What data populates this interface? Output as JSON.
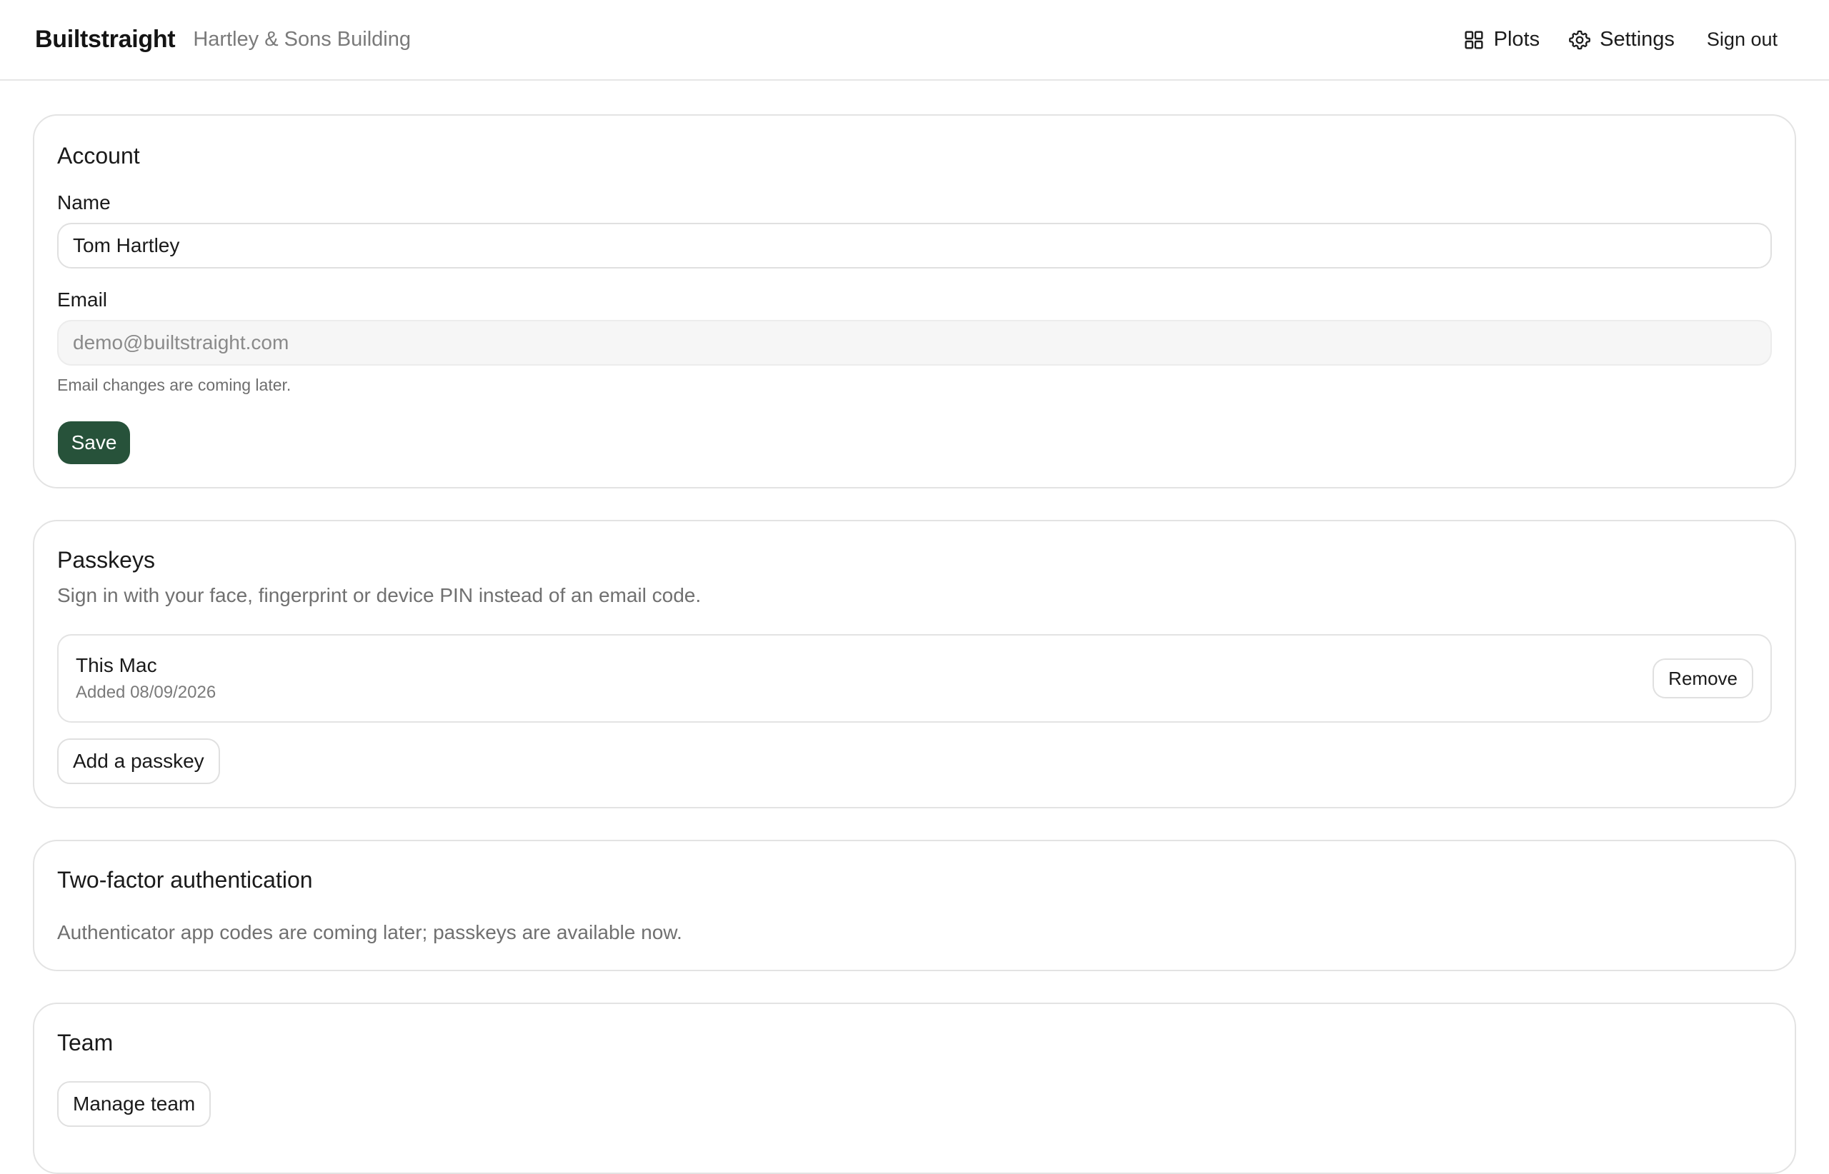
{
  "header": {
    "brand": "Builtstraight",
    "organization": "Hartley & Sons Building",
    "nav": {
      "plots_label": "Plots",
      "plots_icon": "grid-icon",
      "settings_label": "Settings",
      "settings_icon": "gear-icon",
      "signout_label": "Sign out"
    }
  },
  "account": {
    "title": "Account",
    "name_label": "Name",
    "name_value": "Tom Hartley",
    "email_label": "Email",
    "email_value": "demo@builtstraight.com",
    "email_help": "Email changes are coming later.",
    "save_label": "Save"
  },
  "passkeys": {
    "title": "Passkeys",
    "description": "Sign in with your face, fingerprint or device PIN instead of an email code.",
    "items": [
      {
        "name": "This Mac",
        "added": "Added 08/09/2026",
        "remove_label": "Remove"
      }
    ],
    "add_label": "Add a passkey"
  },
  "two_factor": {
    "title": "Two-factor authentication",
    "description": "Authenticator app codes are coming later; passkeys are available now."
  },
  "team": {
    "title": "Team",
    "manage_label": "Manage team"
  },
  "colors": {
    "primary_button": "#27523a",
    "border": "#e3e3e3",
    "muted_text": "#7a7a7a"
  }
}
